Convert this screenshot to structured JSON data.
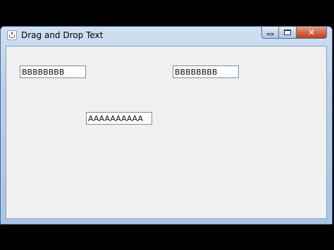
{
  "window": {
    "title": "Drag and Drop Text",
    "app_icon": "java-cup-icon",
    "controls": {
      "minimize_icon": "minimize-icon",
      "maximize_icon": "maximize-icon",
      "close_glyph": "✕"
    }
  },
  "fields": {
    "top_left_value": "BBBBBBBB",
    "top_right_value": "BBBBBBBB",
    "middle_value": "AAAAAAAAAA"
  },
  "colors": {
    "close_button": "#c23c1f",
    "frame": "#b9d1ea",
    "client_background": "#f0f0f0"
  }
}
